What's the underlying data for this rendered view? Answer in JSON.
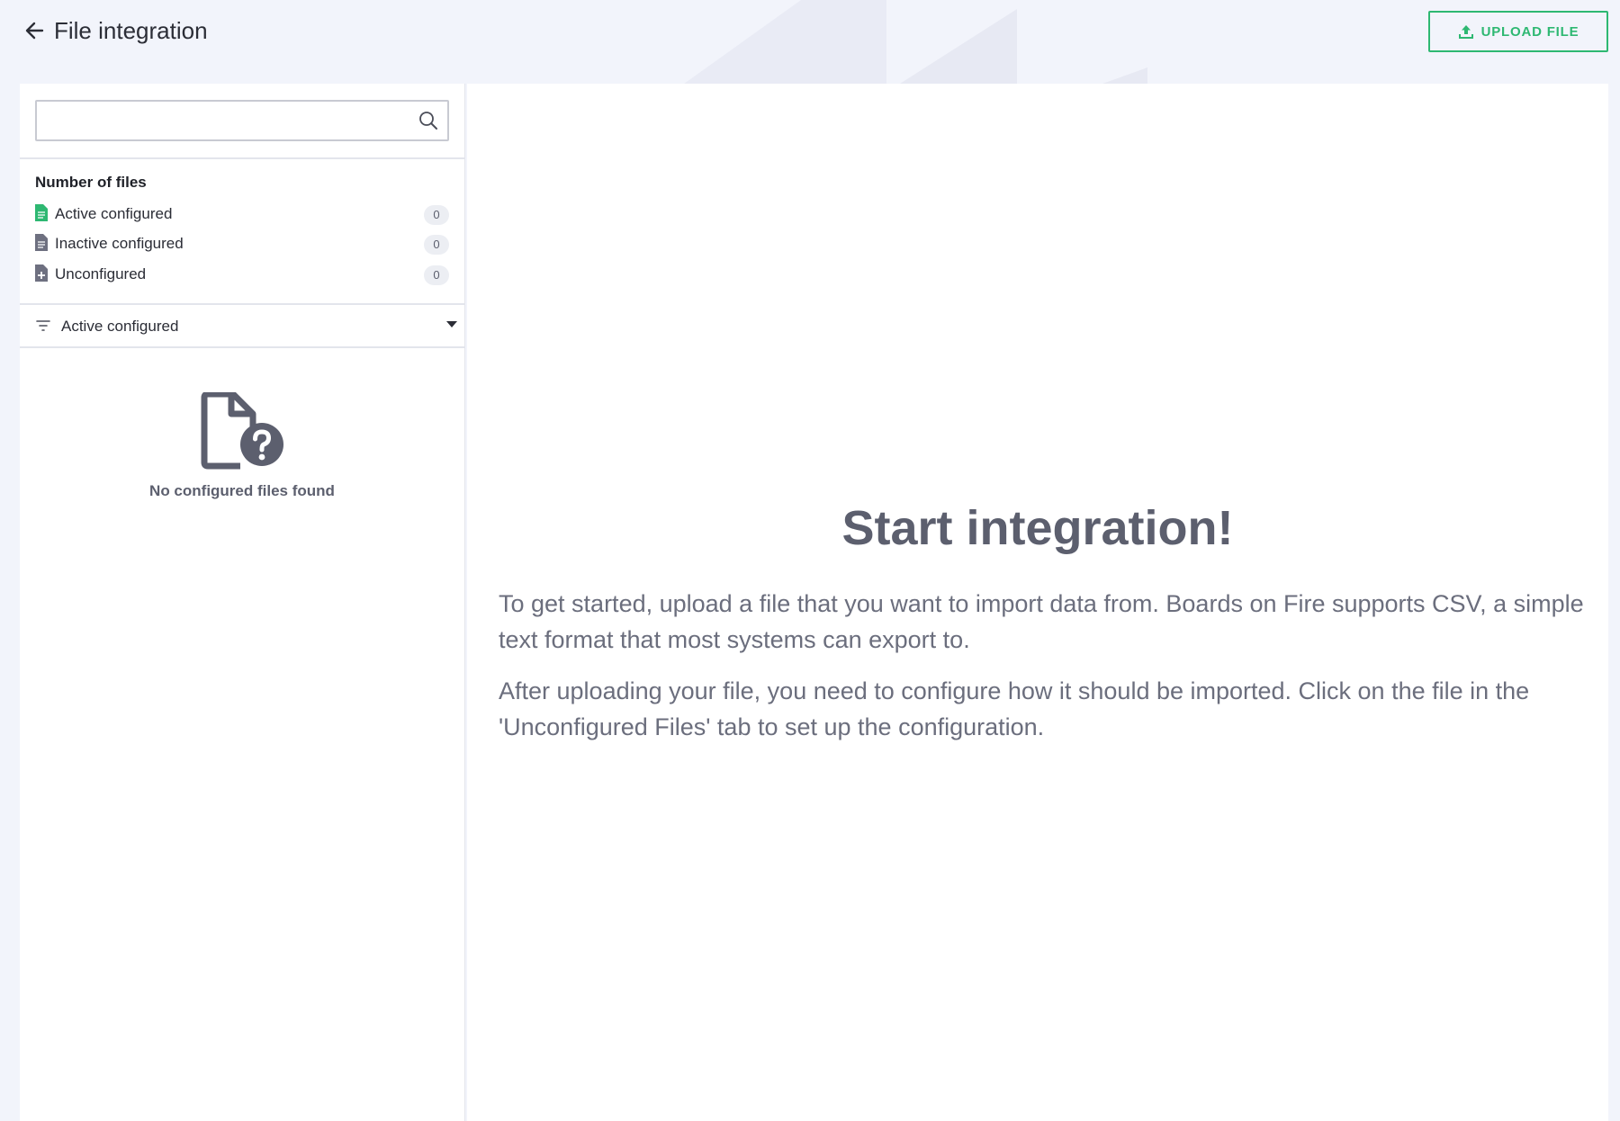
{
  "header": {
    "title": "File integration",
    "upload_label": "UPLOAD FILE"
  },
  "colors": {
    "accent": "#2eb872",
    "text_muted": "#5c5f6e",
    "background": "#f2f4fb"
  },
  "sidebar": {
    "search": {
      "value": "",
      "placeholder": ""
    },
    "counts_title": "Number of files",
    "counts": [
      {
        "label": "Active configured",
        "count": "0",
        "icon": "file-green-icon"
      },
      {
        "label": "Inactive configured",
        "count": "0",
        "icon": "file-gray-icon"
      },
      {
        "label": "Unconfigured",
        "count": "0",
        "icon": "file-plus-icon"
      }
    ],
    "filter": {
      "selected": "Active configured"
    },
    "empty_text": "No configured files found"
  },
  "main": {
    "title": "Start integration!",
    "paragraphs": [
      "To get started, upload a file that you want to import data from. Boards on Fire supports CSV, a simple text format that most systems can export to.",
      "After uploading your file, you need to configure how it should be imported. Click on the file in the 'Unconfigured Files' tab to set up the configuration."
    ]
  }
}
